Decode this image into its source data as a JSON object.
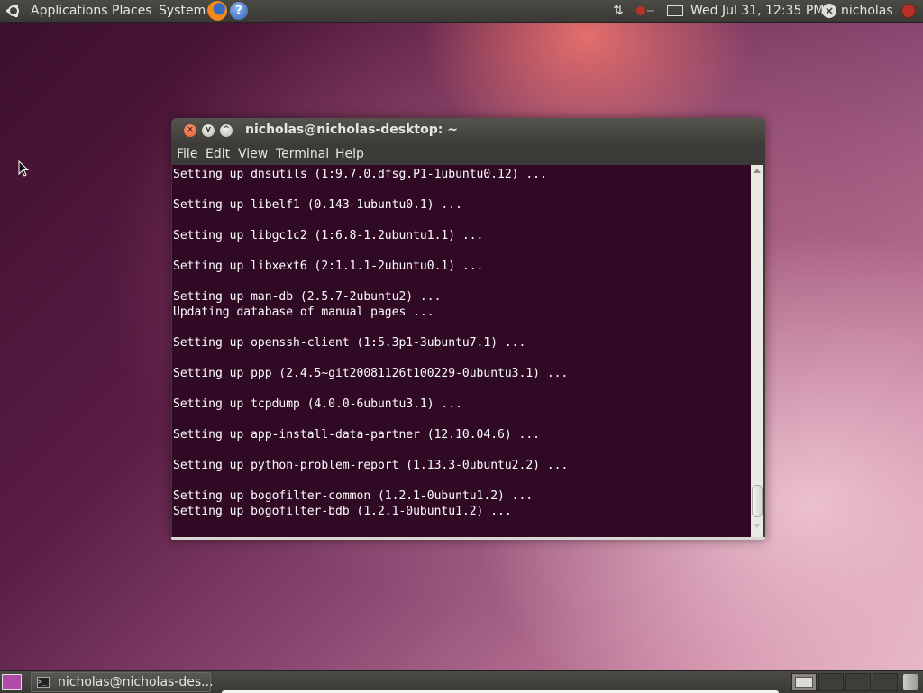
{
  "top_panel": {
    "menus": [
      "Applications",
      "Places",
      "System"
    ],
    "clock": "Wed Jul 31, 12:35 PM",
    "user": "nicholas"
  },
  "window": {
    "title": "nicholas@nicholas-desktop: ~",
    "menu": [
      "File",
      "Edit",
      "View",
      "Terminal",
      "Help"
    ],
    "lines": [
      "Setting up dnsutils (1:9.7.0.dfsg.P1-1ubuntu0.12) ...",
      "",
      "Setting up libelf1 (0.143-1ubuntu0.1) ...",
      "",
      "Setting up libgc1c2 (1:6.8-1.2ubuntu1.1) ...",
      "",
      "Setting up libxext6 (2:1.1.1-2ubuntu0.1) ...",
      "",
      "Setting up man-db (2.5.7-2ubuntu2) ...",
      "Updating database of manual pages ...",
      "",
      "Setting up openssh-client (1:5.3p1-3ubuntu7.1) ...",
      "",
      "Setting up ppp (2.4.5~git20081126t100229-0ubuntu3.1) ...",
      "",
      "Setting up tcpdump (4.0.0-6ubuntu3.1) ...",
      "",
      "Setting up app-install-data-partner (12.10.04.6) ...",
      "",
      "Setting up python-problem-report (1.13.3-0ubuntu2.2) ...",
      "",
      "Setting up bogofilter-common (1.2.1-0ubuntu1.2) ...",
      "Setting up bogofilter-bdb (1.2.1-0ubuntu1.2) ..."
    ]
  },
  "taskbar": {
    "task_label": "nicholas@nicholas-des..."
  },
  "colors": {
    "terminal_bg": "#300a24",
    "panel_bg": "#3c3b37",
    "close_button": "#e0541e"
  },
  "icons": [
    "ubuntu-logo-icon",
    "firefox-icon",
    "help-icon",
    "network-icon",
    "bluetooth-icon",
    "mail-icon",
    "user-icon",
    "power-icon",
    "terminal-icon",
    "trash-icon"
  ]
}
